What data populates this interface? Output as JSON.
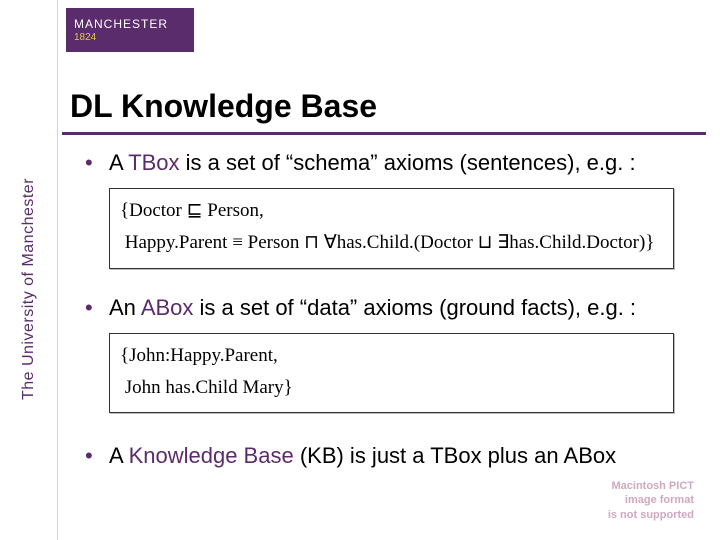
{
  "branding": {
    "logo_line1": "MANCHESTER",
    "logo_line2": "1824",
    "sidebar_text": "The University of Manchester"
  },
  "title": "DL Knowledge Base",
  "bullets": {
    "b1_pre": "A ",
    "b1_kw": "TBox",
    "b1_post": " is a set of “schema” axioms (sentences), e.g. :",
    "box1_line1": "{Doctor ⊑ Person,",
    "box1_line2": " Happy.Parent ≡ Person ⊓ ∀has.Child.(Doctor ⊔ ∃has.Child.Doctor)}",
    "b2_pre": "An ",
    "b2_kw": "ABox",
    "b2_post": " is a set of “data” axioms (ground facts), e.g. :",
    "box2_line1": "{John:Happy.Parent,",
    "box2_line2": " John has.Child Mary}",
    "b3_pre": "A ",
    "b3_kw": "Knowledge Base",
    "b3_post": " (KB) is just a TBox plus an ABox"
  },
  "placeholder": {
    "l1": "Macintosh PICT",
    "l2": "image format",
    "l3": "is not supported"
  }
}
